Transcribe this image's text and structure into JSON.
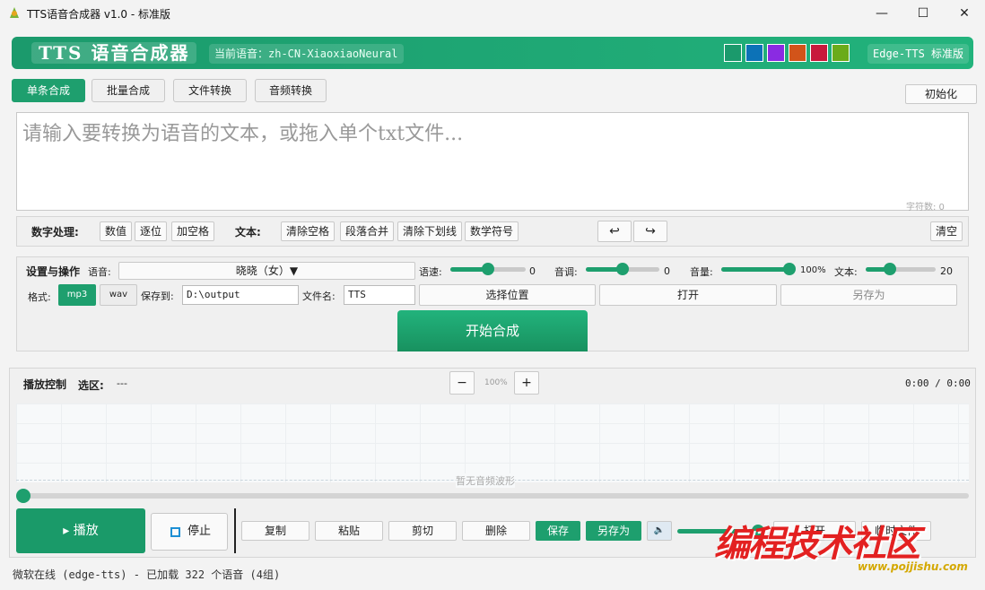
{
  "window": {
    "title": "TTS语音合成器 v1.0 - 标准版",
    "minimize": "—",
    "maximize": "☐",
    "close": "✕"
  },
  "header": {
    "brand": "TTS 语音合成器",
    "voice_label": "当前语音：zh-CN-XiaoxiaoNeural",
    "edition": "Edge-TTS 标准版",
    "swatches": [
      "#1b9a6c",
      "#0c72b7",
      "#8a2be2",
      "#d2541a",
      "#c8193c",
      "#6aab1a"
    ]
  },
  "tabs": {
    "single": "单条合成",
    "batch": "批量合成",
    "file": "文件转换",
    "audio": "音频转换",
    "reset": "初始化"
  },
  "editor": {
    "placeholder": "请输入要转换为语音的文本，或拖入单个txt文件...",
    "char_count": "字符数: 0"
  },
  "numrow": {
    "num_label": "数字处理:",
    "value": "数值",
    "digit": "逐位",
    "space": "加空格",
    "text_label": "文本:",
    "remove_space": "清除空格",
    "merge": "段落合并",
    "underscore": "清除下划线",
    "math": "数学符号",
    "undo": "↩",
    "redo": "↪",
    "clear": "清空"
  },
  "settings": {
    "title": "设置与操作",
    "voice_label": "语音:",
    "voice_value": "晓晓（女）▼",
    "speed_label": "语速:",
    "speed_value": "0",
    "pitch_label": "音调:",
    "pitch_value": "0",
    "volume_label": "音量:",
    "volume_value": "100%",
    "text_label": "文本:",
    "text_value": "20",
    "format_label": "格式:",
    "mp3": "mp3",
    "wav": "wav",
    "save_label": "保存到:",
    "save_path": "D:\\output",
    "filename_label": "文件名:",
    "filename": "TTS",
    "choose": "选择位置",
    "open": "打开",
    "save_as": "另存为",
    "start": "开始合成",
    "levels": {
      "speed": 0.5,
      "pitch": 0.5,
      "volume": 1.0,
      "text": 0.35
    }
  },
  "playback": {
    "title": "播放控制",
    "selection_label": "选区:",
    "selection_value": "---",
    "zoom_out": "−",
    "zoom": "100%",
    "zoom_in": "+",
    "time": "0:00 / 0:00",
    "empty": "暂无音频波形",
    "play": "▸ 播放",
    "stop": "停止",
    "copy": "复制",
    "paste": "粘贴",
    "cut": "剪切",
    "delete": "删除",
    "save": "保存",
    "save_as": "另存为",
    "speaker": "🔈",
    "open_file": "打开",
    "temp": "临时文件"
  },
  "status": "微软在线 (edge-tts) - 已加载 322 个语音 (4组)",
  "watermark": {
    "text": "编程技术社区",
    "url": "www.pojjishu.com"
  }
}
